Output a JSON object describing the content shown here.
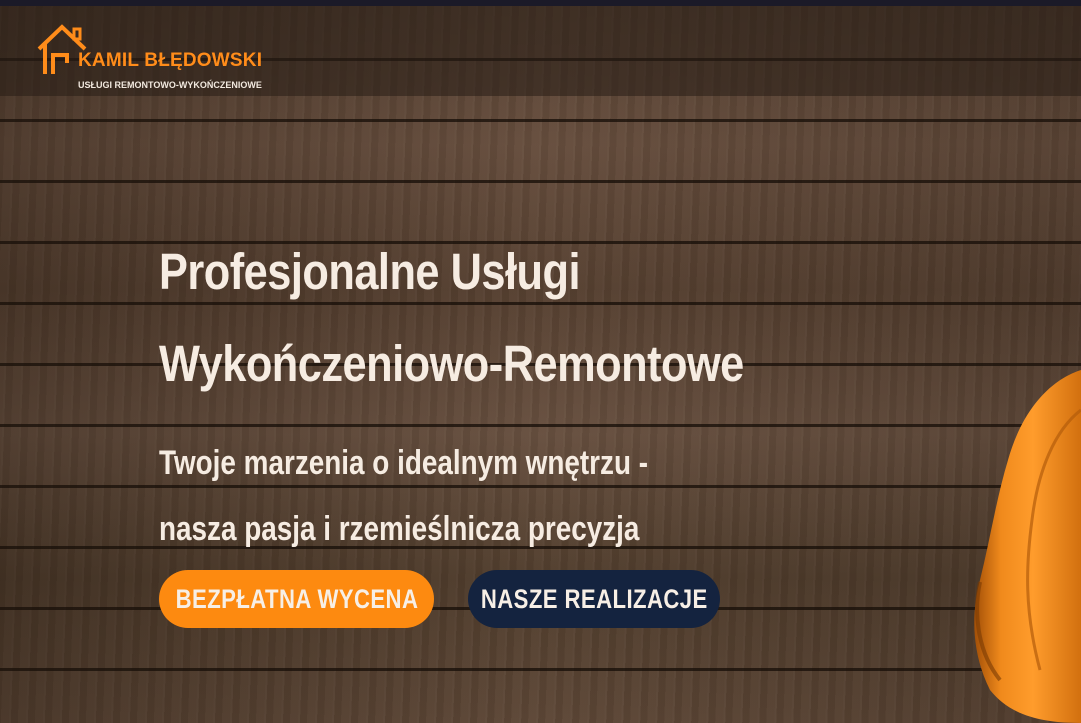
{
  "header": {
    "logo_title": "KAMIL BŁĘDOWSKI",
    "logo_subtitle": "USŁUGI REMONTOWO-WYKOŃCZENIOWE",
    "logo_icon": "house-outline-icon"
  },
  "hero": {
    "title_line1": "Profesjonalne Usługi",
    "title_line2": "Wykończeniowo-Remontowe",
    "tagline_line1": "Twoje marzenia o idealnym wnętrzu -",
    "tagline_line2": "nasza pasja i rzemieślnicza precyzja"
  },
  "buttons": {
    "quote_label": "BEZPŁATNA WYCENA",
    "realizations_label": "NASZE REALIZACJE"
  },
  "colors": {
    "accent": "#fd8a10",
    "navy": "#14233f",
    "text_light": "#f6ece2",
    "wood": "#5b4535"
  },
  "decor": {
    "helmet_icon": "hard-hat-icon"
  }
}
